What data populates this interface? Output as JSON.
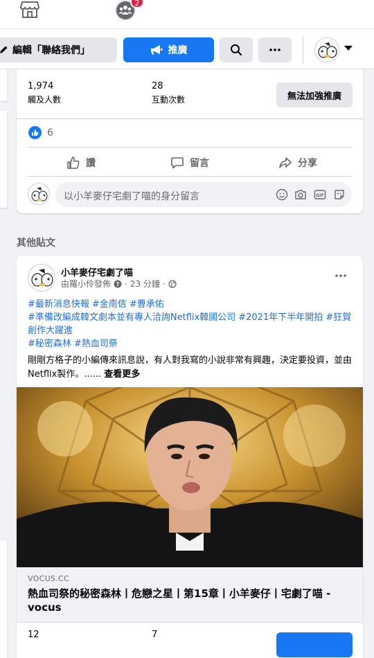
{
  "topnav": {
    "group_badge_count": "2"
  },
  "actionbar": {
    "edit_label": "編輯「聯絡我們」",
    "boost_label": "推廣"
  },
  "post1": {
    "reach_value": "1,974",
    "reach_label": "觸及人數",
    "engagement_value": "28",
    "engagement_label": "互動次數",
    "cannot_boost_label": "無法加強推廣",
    "like_count": "6",
    "actions": {
      "like": "讚",
      "comment": "留言",
      "share": "分享"
    },
    "comment_placeholder": "以小羊麥仔宅劇了喵的身分留言"
  },
  "section": {
    "other_posts_title": "其他貼文"
  },
  "post2": {
    "author": "小羊麥仔宅劇了喵",
    "posted_by": "由羅小伶發佈",
    "time": "23 分鐘",
    "hashtags": [
      "#最新消息快報",
      "#金南佶",
      "#曹承佑",
      "#準備改編成韓文劇本並有專人洽詢Netflix韓國公司",
      "#2021年下半年開拍",
      "#狂賀創作大躍進",
      "#秘密森林",
      "#熱血司祭"
    ],
    "body": "剛剛方格子的小編傳來訊息說，有人對我寫的小說非常有興趣，決定要投資，並由Netflix製作。......",
    "see_more": "查看更多",
    "link_domain": "VOCUS.CC",
    "link_title": "熱血司祭的秘密森林丨危戀之星丨第15章丨小羊麥仔丨宅劇了喵 - vocus",
    "reach_value": "12",
    "engagement_value": "7"
  },
  "colors": {
    "brand_blue": "#1877f2",
    "hashtag_blue": "#216fdb",
    "badge_red": "#e41e3f",
    "background": "#f0f2f5"
  },
  "icons": [
    "store-icon",
    "group-icon",
    "pencil-icon",
    "megaphone-icon",
    "search-icon",
    "more-icon",
    "caret-down-icon",
    "like-icon",
    "comment-icon",
    "share-icon",
    "emoji-icon",
    "camera-icon",
    "gif-icon",
    "sticker-icon",
    "globe-icon",
    "info-icon"
  ]
}
